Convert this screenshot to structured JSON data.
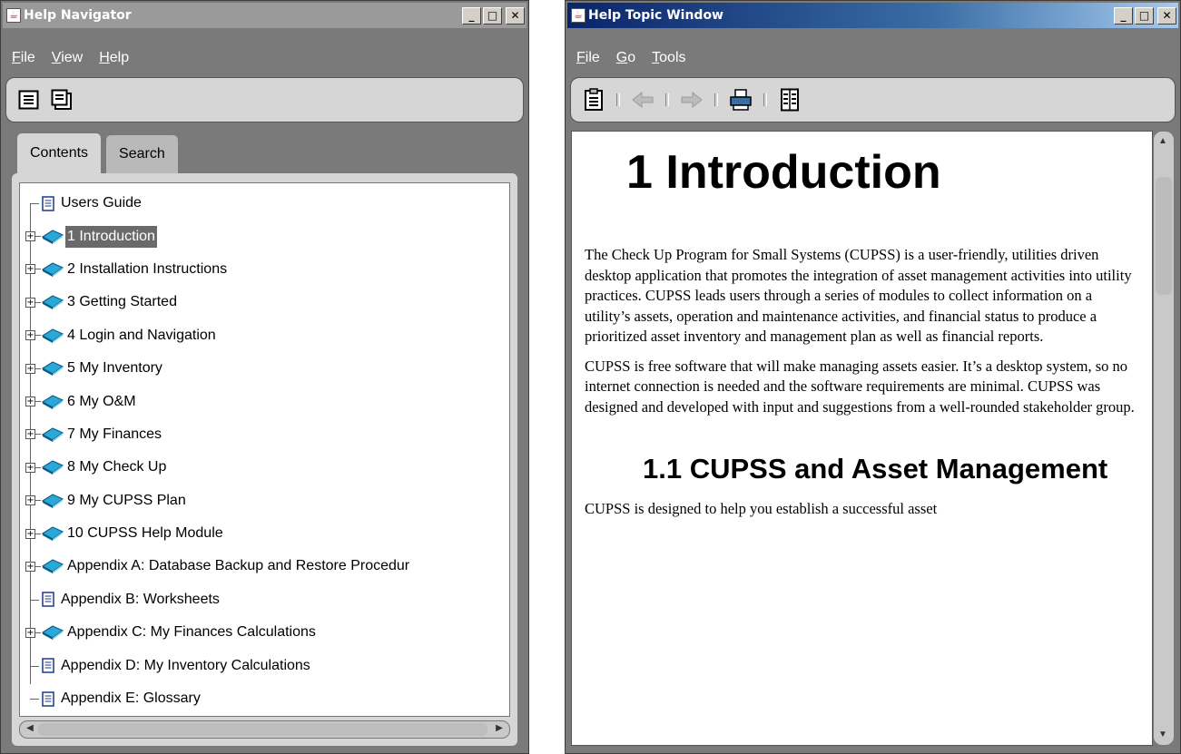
{
  "navigator": {
    "title": "Help Navigator",
    "menu": [
      "File",
      "View",
      "Help"
    ],
    "tabs": [
      "Contents",
      "Search"
    ],
    "tree": [
      {
        "label": "Users Guide",
        "type": "page",
        "expandable": false
      },
      {
        "label": "1 Introduction",
        "type": "book",
        "expandable": true,
        "selected": true
      },
      {
        "label": "2 Installation Instructions",
        "type": "book",
        "expandable": true
      },
      {
        "label": "3 Getting Started",
        "type": "book",
        "expandable": true
      },
      {
        "label": "4 Login and Navigation",
        "type": "book",
        "expandable": true
      },
      {
        "label": "5 My Inventory",
        "type": "book",
        "expandable": true
      },
      {
        "label": "6 My O&M",
        "type": "book",
        "expandable": true
      },
      {
        "label": "7 My Finances",
        "type": "book",
        "expandable": true
      },
      {
        "label": "8 My Check Up",
        "type": "book",
        "expandable": true
      },
      {
        "label": "9 My CUPSS Plan",
        "type": "book",
        "expandable": true
      },
      {
        "label": "10 CUPSS Help Module",
        "type": "book",
        "expandable": true
      },
      {
        "label": "Appendix A: Database Backup and Restore Procedur",
        "type": "book",
        "expandable": true
      },
      {
        "label": "Appendix B: Worksheets",
        "type": "page",
        "expandable": false
      },
      {
        "label": "Appendix C: My Finances Calculations",
        "type": "book",
        "expandable": true
      },
      {
        "label": "Appendix D: My Inventory Calculations",
        "type": "page",
        "expandable": false
      },
      {
        "label": "Appendix E: Glossary",
        "type": "page",
        "expandable": false
      }
    ]
  },
  "topic": {
    "title": "Help Topic Window",
    "menu": [
      "File",
      "Go",
      "Tools"
    ],
    "heading": "1 Introduction",
    "paragraphs": [
      "The Check Up Program for Small Systems (CUPSS) is a user-friendly, utilities driven desktop application that promotes the integration of asset management activities into utility practices.  CUPSS leads users through a series of modules to collect information on a utility’s assets, operation and maintenance activities, and financial status to produce a prioritized asset inventory and management plan as well as financial reports.",
      "CUPSS is free software that will make managing assets easier.  It’s a desktop system, so no internet connection is needed and the software requirements are minimal.  CUPSS was designed and developed with input and suggestions from a well-rounded stakeholder group."
    ],
    "subheading": "1.1 CUPSS and Asset Management",
    "trailing_text": "CUPSS is designed to help you establish a successful asset"
  },
  "colors": {
    "window_bg": "#7a7a7a",
    "toolbar_bg": "#d6d6d6",
    "selection_bg": "#6a6a6a",
    "title_active_start": "#0a246a",
    "title_active_end": "#a6caf0"
  }
}
